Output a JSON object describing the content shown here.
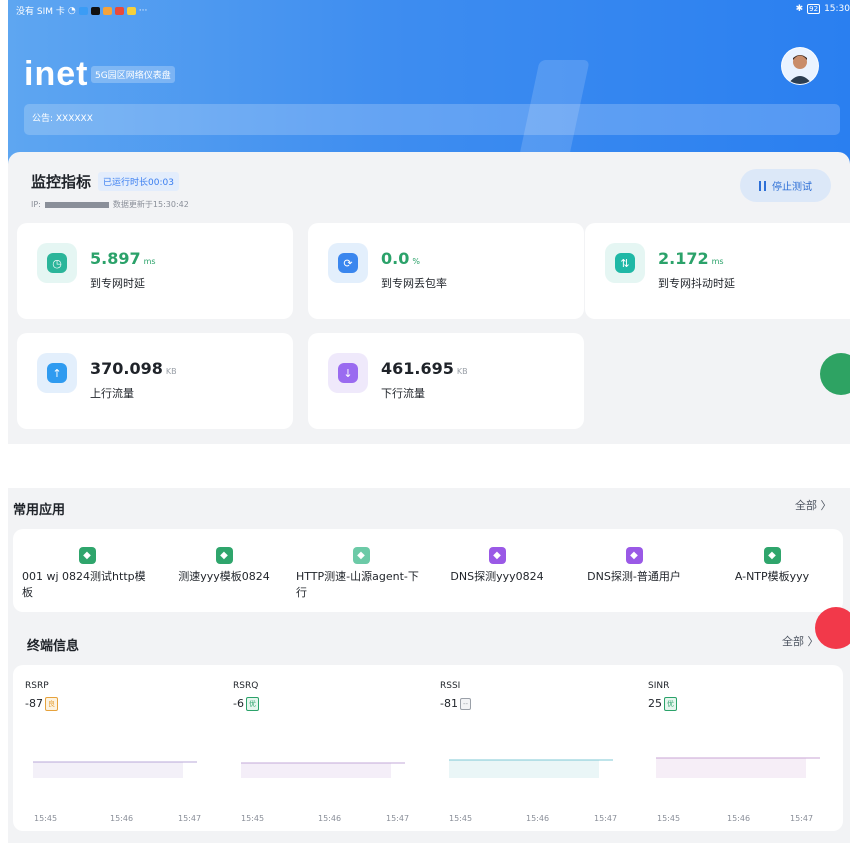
{
  "status_bar": {
    "left": "没有 SIM 卡",
    "dots": "···",
    "battery": "92",
    "time": "15:30"
  },
  "header": {
    "logo": "inet",
    "subtitle": "5G园区网络仪表盘",
    "notice": "公告: XXXXXX"
  },
  "monitor": {
    "title": "监控指标",
    "run_badge": "已运行时长00:03",
    "ip_label": "IP:",
    "updated": "数据更新于15:30:42",
    "stop_button": "停止测试",
    "metrics": [
      {
        "value": "5.897",
        "unit": "ms",
        "label": "到专网时延",
        "icon": "clock-icon"
      },
      {
        "value": "0.0",
        "unit": "%",
        "label": "到专网丢包率",
        "icon": "refresh-icon"
      },
      {
        "value": "2.172",
        "unit": "ms",
        "label": "到专网抖动时延",
        "icon": "jitter-icon"
      },
      {
        "value": "370.098",
        "unit": "KB",
        "label": "上行流量",
        "icon": "upload-icon"
      },
      {
        "value": "461.695",
        "unit": "KB",
        "label": "下行流量",
        "icon": "download-icon"
      }
    ]
  },
  "apps": {
    "title": "常用应用",
    "all": "全部 〉",
    "items": [
      {
        "name": "001 wj 0824测试http模板",
        "color": "#2fa56c"
      },
      {
        "name": "测速yyy模板0824",
        "color": "#2fa56c"
      },
      {
        "name": "HTTP测速-山源agent-下行",
        "color": "#6ccaa7"
      },
      {
        "name": "DNS探测yyy0824",
        "color": "#9a59e6"
      },
      {
        "name": "DNS探测-普通用户",
        "color": "#9a59e6"
      },
      {
        "name": "A-NTP模板yyy",
        "color": "#2fa56c"
      }
    ]
  },
  "terminal": {
    "title": "终端信息",
    "all": "全部 〉",
    "signals": [
      {
        "name": "RSRP",
        "value": "-87",
        "tag": "良",
        "tag_color": "#e6a23c"
      },
      {
        "name": "RSRQ",
        "value": "-6",
        "tag": "优",
        "tag_color": "#2ba26a"
      },
      {
        "name": "RSSI",
        "value": "-81",
        "tag": "--",
        "tag_color": "#9aa0a8"
      },
      {
        "name": "SINR",
        "value": "25",
        "tag": "优",
        "tag_color": "#2ba26a"
      }
    ],
    "ticks": [
      "15:45",
      "15:46",
      "15:47"
    ]
  }
}
